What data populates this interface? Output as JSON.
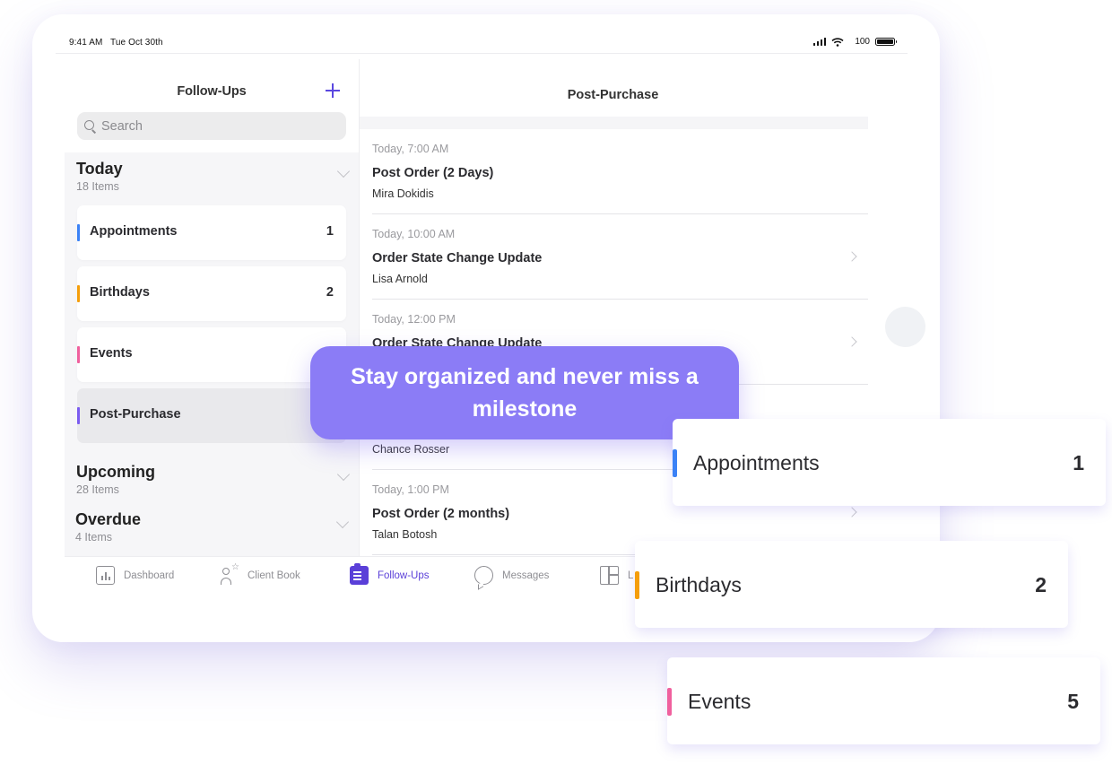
{
  "status_bar": {
    "time": "9:41 AM",
    "date": "Tue Oct 30th",
    "battery": "100",
    "icons": [
      "signal-icon",
      "wifi-icon",
      "battery-icon"
    ]
  },
  "sidebar": {
    "title": "Follow-Ups",
    "add_icon": "plus-icon",
    "search": {
      "placeholder": "Search",
      "value": ""
    },
    "sections": [
      {
        "title": "Today",
        "subtitle": "18 Items",
        "expanded": true
      },
      {
        "title": "Upcoming",
        "subtitle": "28 Items",
        "expanded": false
      },
      {
        "title": "Overdue",
        "subtitle": "4 Items",
        "expanded": false
      }
    ],
    "categories": [
      {
        "label": "Appointments",
        "count": "1",
        "color": "#3b82f6"
      },
      {
        "label": "Birthdays",
        "count": "2",
        "color": "#f59e0b"
      },
      {
        "label": "Events",
        "count": "",
        "color": "#f0609e"
      },
      {
        "label": "Post-Purchase",
        "count": "",
        "color": "#7b5cf0",
        "selected": true
      }
    ]
  },
  "detail": {
    "title": "Post-Purchase",
    "items": [
      {
        "when": "Today, 7:00 AM",
        "what": "Post Order (2 Days)",
        "who": "Mira Dokidis",
        "chevron": false
      },
      {
        "when": "Today, 10:00 AM",
        "what": "Order State Change Update",
        "who": "Lisa Arnold",
        "chevron": true
      },
      {
        "when": "Today, 12:00 PM",
        "what": "Order State Change Update",
        "who": "",
        "chevron": true
      },
      {
        "when": "",
        "what": "",
        "who": "Chance Rosser",
        "chevron": false
      },
      {
        "when": "Today, 1:00 PM",
        "what": "Post Order (2 months)",
        "who": "Talan Botosh",
        "chevron": true
      }
    ]
  },
  "tabbar": {
    "tabs": [
      {
        "label": "Dashboard",
        "icon": "dashboard-icon",
        "active": false
      },
      {
        "label": "Client Book",
        "icon": "client-book-icon",
        "active": false
      },
      {
        "label": "Follow-Ups",
        "icon": "clipboard-icon",
        "active": true
      },
      {
        "label": "Messages",
        "icon": "chat-bubble-icon",
        "active": false
      },
      {
        "label": "L",
        "icon": "layout-icon",
        "active": false
      }
    ]
  },
  "callout": {
    "text": "Stay organized and never miss a milestone"
  },
  "floating_cards": [
    {
      "label": "Appointments",
      "count": "1",
      "color": "#3b82f6"
    },
    {
      "label": "Birthdays",
      "count": "2",
      "color": "#f59e0b"
    },
    {
      "label": "Events",
      "count": "5",
      "color": "#f0609e"
    }
  ],
  "colors": {
    "accent": "#5a3fd8",
    "callout_bg": "#8b7cf6"
  }
}
